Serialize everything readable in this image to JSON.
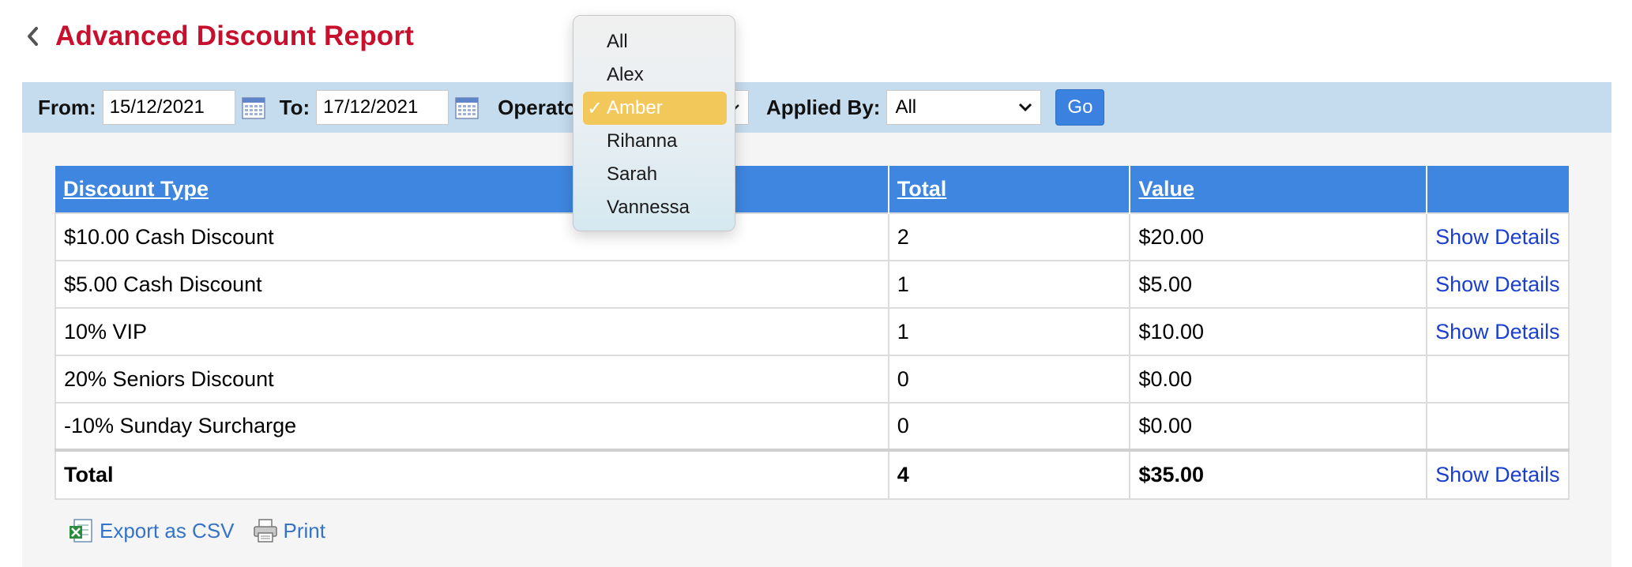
{
  "page": {
    "title": "Advanced Discount Report"
  },
  "filters": {
    "from_label": "From:",
    "from_value": "15/12/2021",
    "to_label": "To:",
    "to_value": "17/12/2021",
    "operator_label": "Operator",
    "applied_by_label": "Applied By:",
    "applied_by_value": "All",
    "go_label": "Go"
  },
  "operator_dropdown": {
    "options": [
      "All",
      "Alex",
      "Amber",
      "Rihanna",
      "Sarah",
      "Vannessa"
    ],
    "selected": "Amber",
    "checkmark": "✓"
  },
  "table": {
    "headers": [
      "Discount Type",
      "Total",
      "Value",
      ""
    ],
    "rows": [
      {
        "type": "$10.00 Cash Discount",
        "total": "2",
        "value": "$20.00",
        "action": "Show Details"
      },
      {
        "type": "$5.00 Cash Discount",
        "total": "1",
        "value": "$5.00",
        "action": "Show Details"
      },
      {
        "type": "10% VIP",
        "total": "1",
        "value": "$10.00",
        "action": "Show Details"
      },
      {
        "type": "20% Seniors Discount",
        "total": "0",
        "value": "$0.00",
        "action": ""
      },
      {
        "type": "-10% Sunday Surcharge",
        "total": "0",
        "value": "$0.00",
        "action": ""
      }
    ],
    "total_row": {
      "label": "Total",
      "total": "4",
      "value": "$35.00",
      "action": "Show Details"
    }
  },
  "footer": {
    "export_label": "Export as CSV",
    "print_label": "Print"
  },
  "colors": {
    "title": "#c8102e",
    "filter_bar": "#c5dcee",
    "header": "#3e86e0",
    "go_button": "#3b82e0",
    "link": "#1a3fcf",
    "selected_option": "#f3c85a"
  },
  "icons": [
    "chevron-left-icon",
    "calendar-icon",
    "chevron-down-icon",
    "excel-icon",
    "printer-icon",
    "checkmark-icon"
  ]
}
